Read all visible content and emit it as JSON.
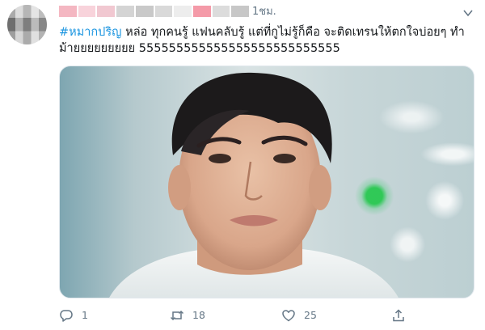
{
  "tweet": {
    "time": "1ชม.",
    "hashtag": "#หมากปริญ",
    "text_line1": " หล่อ ทุกคนรู้ แฟนคลับรู้ แต่ที่กูไม่รู้ก็คือ จะติดเทรนให้ตกใจบ่อยๆ ทำ",
    "text_line2": "ม้ายยยยยยยยย 555555555555555555555555555",
    "name_blur_colors": [
      "#f4b7c2",
      "#f8d3db",
      "#f1c8d1",
      "#d4d4d4",
      "#c9c9c9",
      "#d9d9d9",
      "#ededed",
      "#f49aa8",
      "#dcdcdc",
      "#c7c7c7"
    ]
  },
  "actions": {
    "reply_count": "1",
    "retweet_count": "18",
    "like_count": "25"
  },
  "icons": {
    "reply": "reply-icon",
    "retweet": "retweet-icon",
    "like": "heart-icon",
    "share": "share-icon",
    "caret": "chevron-down-icon"
  }
}
